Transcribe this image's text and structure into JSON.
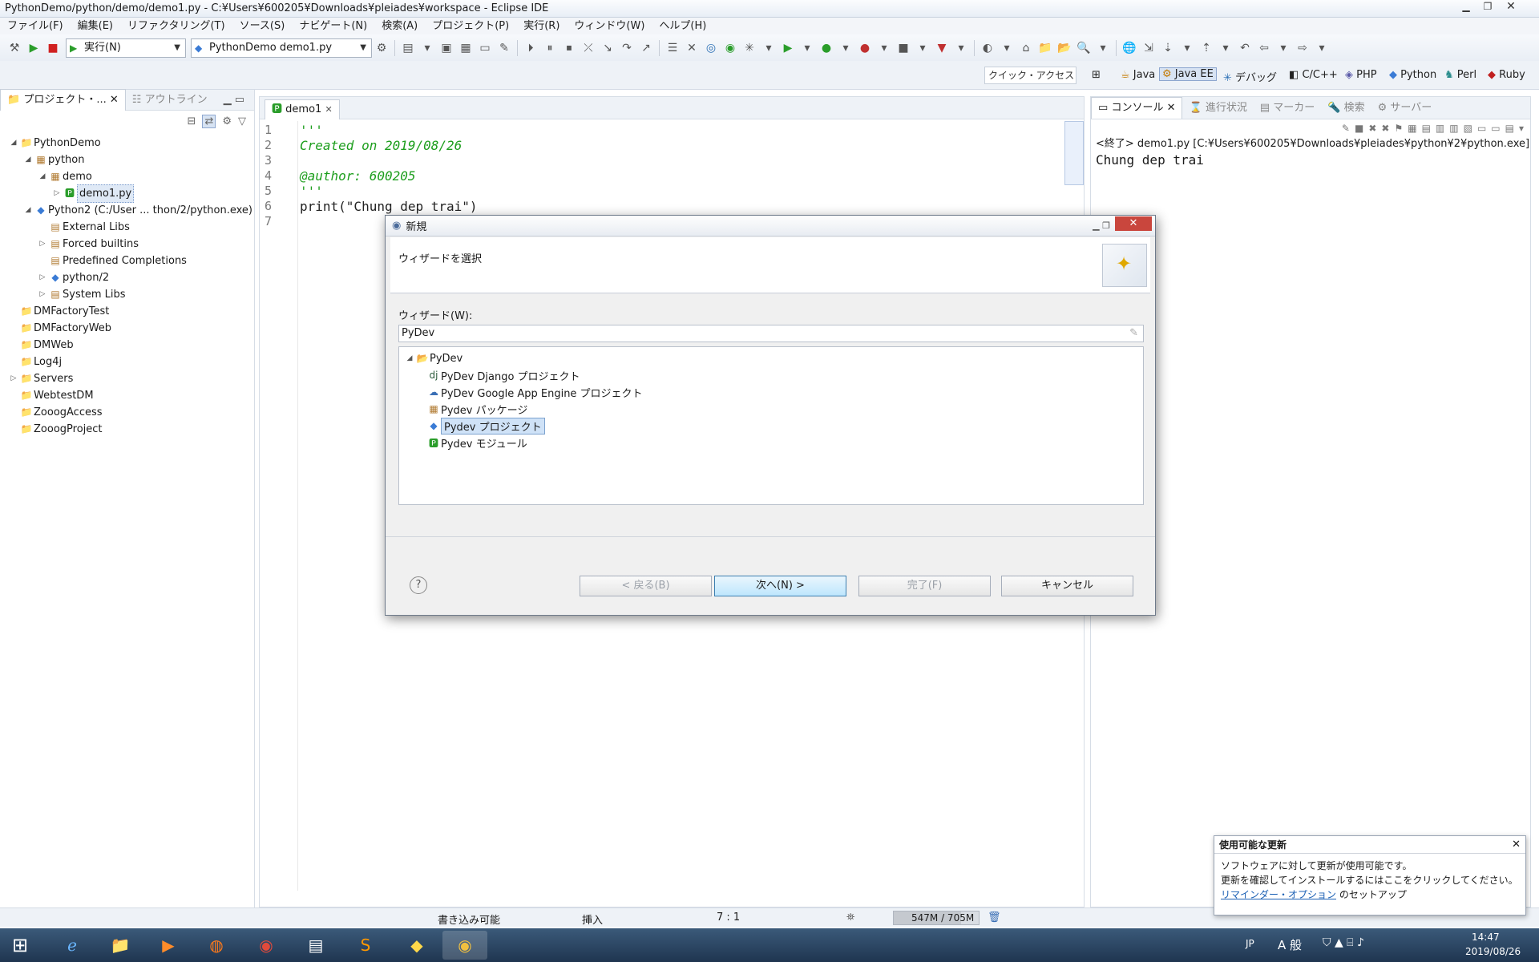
{
  "window": {
    "title": "PythonDemo/python/demo/demo1.py - C:¥Users¥600205¥Downloads¥pleiades¥workspace - Eclipse IDE"
  },
  "menu": [
    "ファイル(F)",
    "編集(E)",
    "リファクタリング(T)",
    "ソース(S)",
    "ナビゲート(N)",
    "検索(A)",
    "プロジェクト(P)",
    "実行(R)",
    "ウィンドウ(W)",
    "ヘルプ(H)"
  ],
  "toolbar": {
    "run_combo": "実行(N)",
    "config_combo": "PythonDemo demo1.py"
  },
  "quick_access": "クイック・アクセス",
  "perspectives": [
    "Java",
    "Java EE",
    "デバッグ",
    "C/C++",
    "PHP",
    "Python",
    "Perl",
    "Ruby"
  ],
  "left_tabs": {
    "project": "プロジェクト・...",
    "outline": "アウトライン"
  },
  "tree": [
    {
      "label": "PythonDemo",
      "depth": 0,
      "tw": "◢",
      "icon": "project"
    },
    {
      "label": "python",
      "depth": 1,
      "tw": "◢",
      "icon": "package"
    },
    {
      "label": "demo",
      "depth": 2,
      "tw": "◢",
      "icon": "package"
    },
    {
      "label": "demo1.py",
      "depth": 3,
      "tw": "▷",
      "icon": "file",
      "selected": true
    },
    {
      "label": "Python2  (C:/User ... thon/2/python.exe)",
      "depth": 1,
      "tw": "◢",
      "icon": "python"
    },
    {
      "label": "External Libs",
      "depth": 2,
      "tw": "",
      "icon": "lib"
    },
    {
      "label": "Forced builtins",
      "depth": 2,
      "tw": "▷",
      "icon": "lib"
    },
    {
      "label": "Predefined Completions",
      "depth": 2,
      "tw": "",
      "icon": "lib"
    },
    {
      "label": "python/2",
      "depth": 2,
      "tw": "▷",
      "icon": "python"
    },
    {
      "label": "System Libs",
      "depth": 2,
      "tw": "▷",
      "icon": "lib"
    },
    {
      "label": "DMFactoryTest",
      "depth": 0,
      "tw": "",
      "icon": "folder"
    },
    {
      "label": "DMFactoryWeb",
      "depth": 0,
      "tw": "",
      "icon": "folder"
    },
    {
      "label": "DMWeb",
      "depth": 0,
      "tw": "",
      "icon": "folder"
    },
    {
      "label": "Log4j",
      "depth": 0,
      "tw": "",
      "icon": "folder"
    },
    {
      "label": "Servers",
      "depth": 0,
      "tw": "▷",
      "icon": "folder"
    },
    {
      "label": "WebtestDM",
      "depth": 0,
      "tw": "",
      "icon": "folder"
    },
    {
      "label": "ZooogAccess",
      "depth": 0,
      "tw": "",
      "icon": "folder"
    },
    {
      "label": "ZooogProject",
      "depth": 0,
      "tw": "",
      "icon": "folder"
    }
  ],
  "editor": {
    "tab": "demo1",
    "lines": [
      {
        "n": "1",
        "text": "'''"
      },
      {
        "n": "2",
        "text": "Created on 2019/08/26"
      },
      {
        "n": "3",
        "text": ""
      },
      {
        "n": "4",
        "text": "@author: 600205"
      },
      {
        "n": "5",
        "text": "'''"
      },
      {
        "n": "6",
        "text": "print(\"Chung dep trai\")"
      },
      {
        "n": "7",
        "text": ""
      }
    ]
  },
  "console": {
    "tabs": [
      "コンソール",
      "進行状況",
      "マーカー",
      "検索",
      "サーバー"
    ],
    "header": "<終了> demo1.py [C:¥Users¥600205¥Downloads¥pleiades¥python¥2¥python.exe]",
    "output": "Chung dep trai"
  },
  "dialog": {
    "title": "新規",
    "heading": "ウィザードを選択",
    "wizard_label": "ウィザード(W):",
    "filter": "PyDev",
    "tree_root": "PyDev",
    "items": [
      "PyDev Django プロジェクト",
      "PyDev Google App Engine プロジェクト",
      "Pydev パッケージ",
      "Pydev プロジェクト",
      "Pydev モジュール"
    ],
    "selected": "Pydev プロジェクト",
    "buttons": {
      "back": "< 戻る(B)",
      "next": "次へ(N) >",
      "finish": "完了(F)",
      "cancel": "キャンセル"
    }
  },
  "statusbar": {
    "writable": "書き込み可能",
    "insert": "挿入",
    "position": "7 : 1",
    "memory": "547M / 705M"
  },
  "notification": {
    "title": "使用可能な更新",
    "line1": "ソフトウェアに対して更新が使用可能です。",
    "line2": "更新を確認してインストールするにはここをクリックしてください。",
    "link": "リマインダー・オプション",
    "link_suffix": " のセットアップ"
  },
  "taskbar": {
    "ime_lang": "JP",
    "ime_mode": "A 般",
    "time": "14:47",
    "date": "2019/08/26"
  },
  "colors": {
    "selection": "#dfe9f6",
    "string_green": "#1d9e1d",
    "accent": "#3c7fb1"
  }
}
